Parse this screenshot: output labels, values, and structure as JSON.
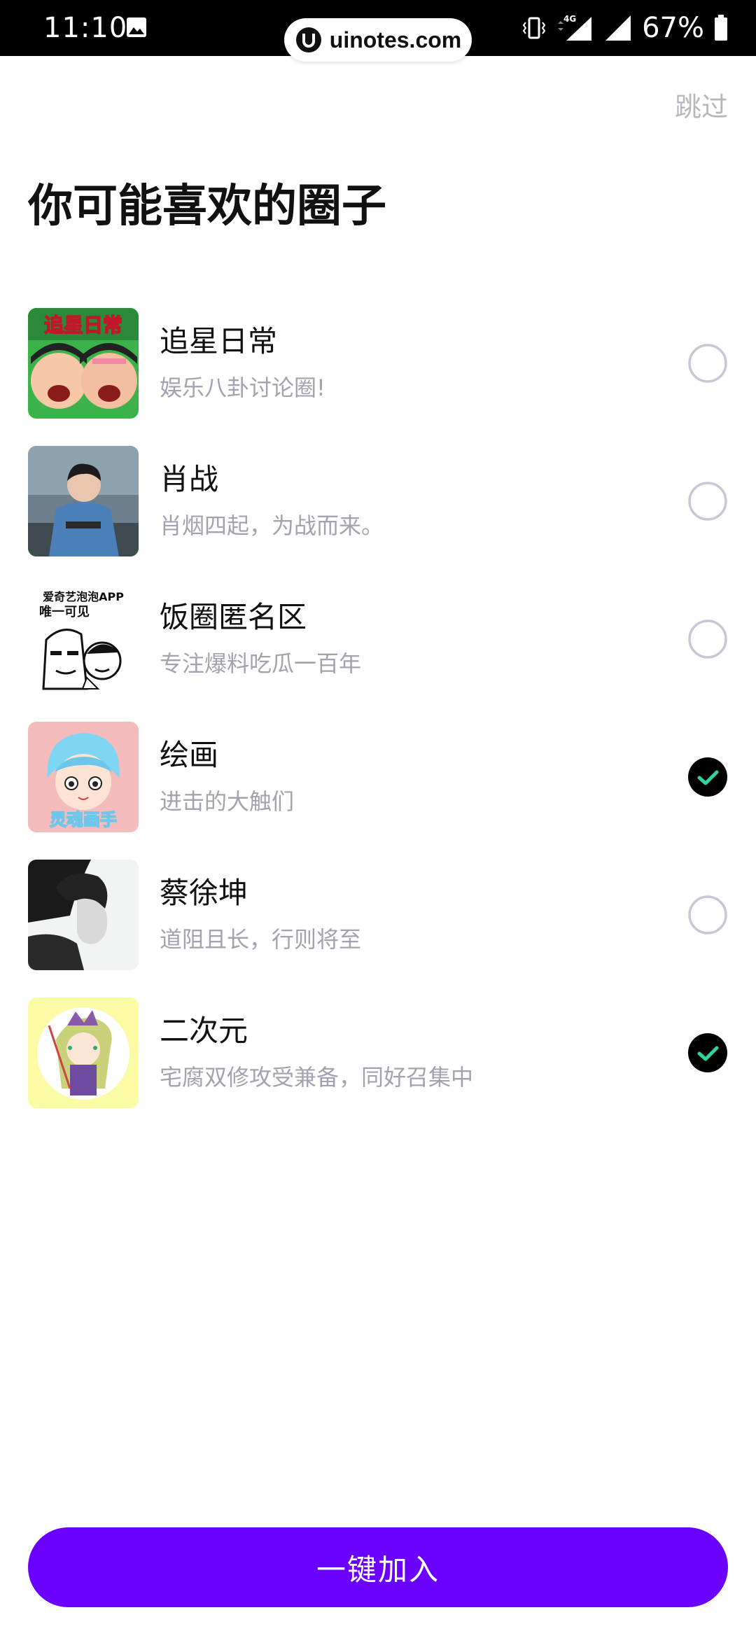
{
  "status_bar": {
    "time": "11:10",
    "battery": "67%",
    "network": "4G"
  },
  "watermark": {
    "text": "uinotes.com"
  },
  "header": {
    "skip_label": "跳过",
    "title": "你可能喜欢的圈子"
  },
  "circles": [
    {
      "name": "追星日常",
      "desc": "娱乐八卦讨论圈!",
      "selected": false,
      "thumb_text": "追星日常"
    },
    {
      "name": "肖战",
      "desc": "肖烟四起，为战而来。",
      "selected": false
    },
    {
      "name": "饭圈匿名区",
      "desc": "专注爆料吃瓜一百年",
      "selected": false,
      "thumb_text_1": "爱奇艺泡泡APP",
      "thumb_text_2": "唯一可见"
    },
    {
      "name": "绘画",
      "desc": "进击的大触们",
      "selected": true,
      "thumb_text": "灵魂画手"
    },
    {
      "name": "蔡徐坤",
      "desc": "道阻且长，行则将至",
      "selected": false
    },
    {
      "name": "二次元",
      "desc": "宅腐双修攻受兼备，同好召集中",
      "selected": true
    }
  ],
  "footer": {
    "join_label": "一键加入"
  },
  "colors": {
    "accent": "#6a00ff",
    "check": "#2ed3a3",
    "unselected_ring": "#c9c7d6",
    "desc": "#a3a3b0"
  }
}
